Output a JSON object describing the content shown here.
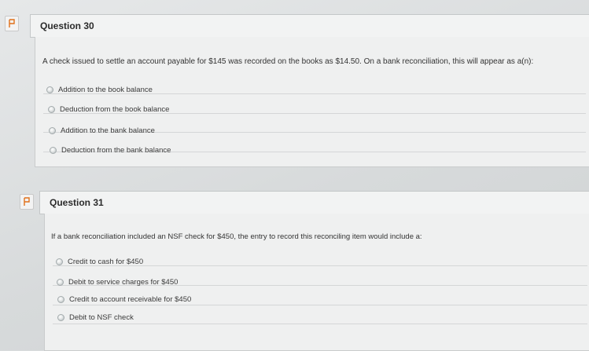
{
  "q30": {
    "title": "Question 30",
    "text": "A check issued to settle an account payable for $145 was recorded on the books as $14.50. On a bank reconciliation, this will appear as a(n):",
    "options": [
      "Addition to the book balance",
      "Deduction from the book balance",
      "Addition to the bank balance",
      "Deduction from the bank balance"
    ]
  },
  "q31": {
    "title": "Question 31",
    "text": "If a bank reconciliation included an NSF check for $450, the entry to record this reconciling item would include a:",
    "options": [
      "Credit to cash for $450",
      "Debit to service charges for $450",
      "Credit to account receivable for $450",
      "Debit to NSF check"
    ]
  },
  "colors": {
    "background": "#d9dcdd",
    "header": "#f2f3f3",
    "flag_accent": "#e0701a"
  }
}
